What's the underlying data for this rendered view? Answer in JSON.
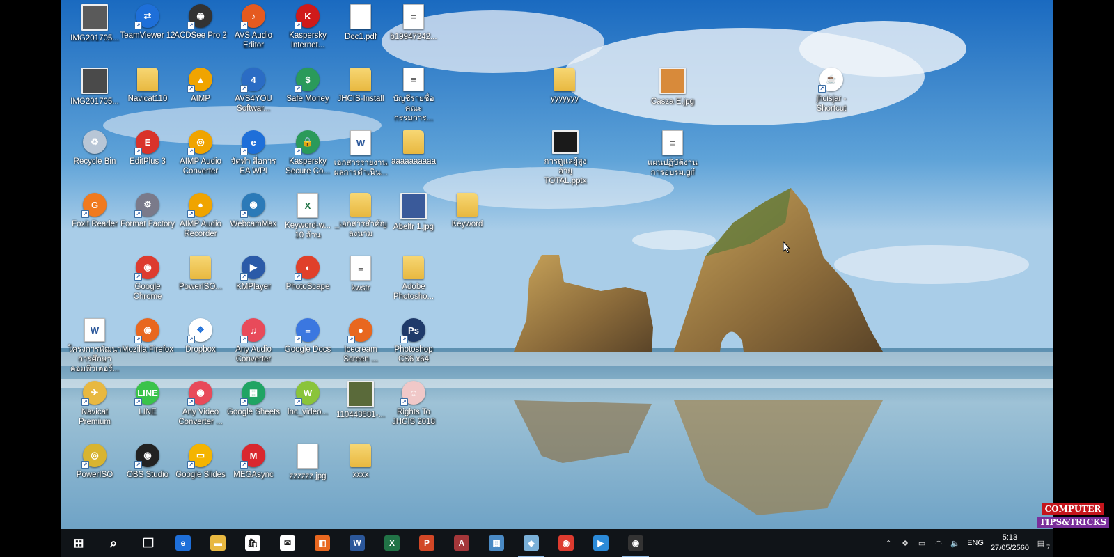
{
  "desktop": {
    "icons": [
      {
        "label": "IMG201705...",
        "name": "icon-img201705-1",
        "kind": "photo",
        "color": "#5a5a5a",
        "glyph": "",
        "shortcut": false
      },
      {
        "label": "TeamViewer 12",
        "name": "icon-teamviewer",
        "kind": "app",
        "color": "#1e6fd9",
        "glyph": "⇄",
        "shortcut": true
      },
      {
        "label": "ACDSee Pro 2",
        "name": "icon-acdsee",
        "kind": "app",
        "color": "#333",
        "glyph": "◉",
        "shortcut": true
      },
      {
        "label": "AVS Audio Editor",
        "name": "icon-avs-audio-editor",
        "kind": "app",
        "color": "#e55a1f",
        "glyph": "♪",
        "shortcut": true
      },
      {
        "label": "Kaspersky Internet...",
        "name": "icon-kaspersky-internet",
        "kind": "app",
        "color": "#d01a1a",
        "glyph": "K",
        "shortcut": true
      },
      {
        "label": "Doc1.pdf",
        "name": "icon-doc1-pdf",
        "kind": "file",
        "color": "#ffffff",
        "glyph": "",
        "shortcut": false
      },
      {
        "label": "b19947242...",
        "name": "icon-b19947242",
        "kind": "file",
        "color": "#ffffff",
        "glyph": "≡",
        "shortcut": false
      },
      {
        "label": "IMG201705...",
        "name": "icon-img201705-2",
        "kind": "photo",
        "color": "#4a4a4a",
        "glyph": "",
        "shortcut": false
      },
      {
        "label": "Navicat110",
        "name": "icon-navicat110",
        "kind": "folder",
        "color": "#e8b840",
        "glyph": "",
        "shortcut": false
      },
      {
        "label": "AIMP",
        "name": "icon-aimp",
        "kind": "app",
        "color": "#f0a400",
        "glyph": "▲",
        "shortcut": true
      },
      {
        "label": "AVS4YOU Softwar...",
        "name": "icon-avs4you",
        "kind": "app",
        "color": "#2b6cc4",
        "glyph": "4",
        "shortcut": true
      },
      {
        "label": "Safe Money",
        "name": "icon-safe-money",
        "kind": "app",
        "color": "#2a9a5a",
        "glyph": "$",
        "shortcut": true
      },
      {
        "label": "JHCIS-Install",
        "name": "icon-jhcis-install",
        "kind": "folder",
        "color": "#e8b840",
        "glyph": "",
        "shortcut": false
      },
      {
        "label": "บัญชีรายชื่อ คณะกรรมการ...",
        "name": "icon-thai-doc-1",
        "kind": "file",
        "color": "#ffffff",
        "glyph": "≡",
        "shortcut": false
      },
      {
        "label": "Recycle Bin",
        "name": "icon-recycle-bin",
        "kind": "app",
        "color": "#b8c6d6",
        "glyph": "♻",
        "shortcut": false
      },
      {
        "label": "EditPlus 3",
        "name": "icon-editplus",
        "kind": "app",
        "color": "#d9332a",
        "glyph": "E",
        "shortcut": true
      },
      {
        "label": "AIMP Audio Converter",
        "name": "icon-aimp-audio-converter",
        "kind": "app",
        "color": "#f0a400",
        "glyph": "◎",
        "shortcut": true
      },
      {
        "label": "จัดทำ สื่อการ EA WPI",
        "name": "icon-thai-ie-shortcut",
        "kind": "app",
        "color": "#1e6fd9",
        "glyph": "e",
        "shortcut": true
      },
      {
        "label": "Kaspersky Secure Co...",
        "name": "icon-kaspersky-secure",
        "kind": "app",
        "color": "#2a9a5a",
        "glyph": "🔒",
        "shortcut": true
      },
      {
        "label": "เอกสารรายงาน ผลการดำเนิน...",
        "name": "icon-thai-word-doc",
        "kind": "word",
        "color": "#2b579a",
        "glyph": "W",
        "shortcut": false
      },
      {
        "label": "aaaaaaaaaa",
        "name": "icon-aaaaaaaaaa",
        "kind": "folder",
        "color": "#e8b840",
        "glyph": "",
        "shortcut": false
      },
      {
        "label": "Foxit Reader",
        "name": "icon-foxit-reader",
        "kind": "app",
        "color": "#f07a1f",
        "glyph": "G",
        "shortcut": true
      },
      {
        "label": "Format Factory",
        "name": "icon-format-factory",
        "kind": "app",
        "color": "#7a7a8a",
        "glyph": "⚙",
        "shortcut": true
      },
      {
        "label": "AIMP Audio Recorder",
        "name": "icon-aimp-audio-recorder",
        "kind": "app",
        "color": "#f0a400",
        "glyph": "●",
        "shortcut": true
      },
      {
        "label": "WebcamMax",
        "name": "icon-webcammax",
        "kind": "app",
        "color": "#2b7ab8",
        "glyph": "◉",
        "shortcut": true
      },
      {
        "label": "Keyword-w... 10 ล้าน",
        "name": "icon-keyword-excel",
        "kind": "excel",
        "color": "#217346",
        "glyph": "X",
        "shortcut": false
      },
      {
        "label": "_เอกสารสำคัญ ลงนาม",
        "name": "icon-thai-folder",
        "kind": "folder",
        "color": "#e8b840",
        "glyph": "",
        "shortcut": false
      },
      {
        "label": "Abeltr 1.jpg",
        "name": "icon-abeltr-jpg",
        "kind": "photo",
        "color": "#3a5a9a",
        "glyph": "",
        "shortcut": false
      },
      {
        "label": "Keyword",
        "name": "icon-keyword-folder",
        "kind": "folder",
        "color": "#e8b840",
        "glyph": "",
        "shortcut": false
      },
      {
        "label": "Google Chrome",
        "name": "icon-google-chrome",
        "kind": "app",
        "color": "#dd3b2f",
        "glyph": "◉",
        "shortcut": true
      },
      {
        "label": "PowerISO...",
        "name": "icon-poweriso-folder",
        "kind": "folder",
        "color": "#e8b840",
        "glyph": "",
        "shortcut": false
      },
      {
        "label": "KMPlayer",
        "name": "icon-kmplayer",
        "kind": "app",
        "color": "#2b5aa8",
        "glyph": "▶",
        "shortcut": true
      },
      {
        "label": "PhotoScape",
        "name": "icon-photoscape",
        "kind": "app",
        "color": "#e0402a",
        "glyph": "◐",
        "shortcut": true
      },
      {
        "label": "kwstr",
        "name": "icon-kwstr",
        "kind": "file",
        "color": "#ffffff",
        "glyph": "≡",
        "shortcut": false
      },
      {
        "label": "Adobe Photosho...",
        "name": "icon-adobe-photoshop-folder",
        "kind": "folder",
        "color": "#e8b840",
        "glyph": "",
        "shortcut": false
      },
      {
        "label": "โครงการพัฒนา การศึกษาคอมพิวเตอร์...",
        "name": "icon-thai-word-doc-2",
        "kind": "word",
        "color": "#2b579a",
        "glyph": "W",
        "shortcut": false
      },
      {
        "label": "Mozilla Firefox",
        "name": "icon-mozilla-firefox",
        "kind": "app",
        "color": "#e8671f",
        "glyph": "◉",
        "shortcut": true
      },
      {
        "label": "Dropbox",
        "name": "icon-dropbox",
        "kind": "app",
        "color": "#ffffff",
        "glyph": "❖",
        "shortcut": true
      },
      {
        "label": "Any Audio Converter",
        "name": "icon-any-audio-converter",
        "kind": "app",
        "color": "#e84a5a",
        "glyph": "♫",
        "shortcut": true
      },
      {
        "label": "Google Docs",
        "name": "icon-google-docs",
        "kind": "app",
        "color": "#3b77e0",
        "glyph": "≡",
        "shortcut": true
      },
      {
        "label": "Icecream Screen ...",
        "name": "icon-icecream-screen",
        "kind": "app",
        "color": "#e8671f",
        "glyph": "●",
        "shortcut": true
      },
      {
        "label": "Photoshop CS6 x64",
        "name": "icon-photoshop-cs6",
        "kind": "app",
        "color": "#1f3a6a",
        "glyph": "Ps",
        "shortcut": true
      },
      {
        "label": "Navicat Premium",
        "name": "icon-navicat-premium",
        "kind": "app",
        "color": "#e8b840",
        "glyph": "✈",
        "shortcut": true
      },
      {
        "label": "LINE",
        "name": "icon-line",
        "kind": "app",
        "color": "#3ac34a",
        "glyph": "LINE",
        "shortcut": true
      },
      {
        "label": "Any Video Converter ...",
        "name": "icon-any-video-converter",
        "kind": "app",
        "color": "#e84a5a",
        "glyph": "◉",
        "shortcut": true
      },
      {
        "label": "Google Sheets",
        "name": "icon-google-sheets",
        "kind": "app",
        "color": "#1fa463",
        "glyph": "▦",
        "shortcut": true
      },
      {
        "label": "lnc_video...",
        "name": "icon-lnc-video",
        "kind": "app",
        "color": "#8ac43a",
        "glyph": "W",
        "shortcut": true
      },
      {
        "label": "110443581-...",
        "name": "icon-110443581",
        "kind": "photo",
        "color": "#5a6a3a",
        "glyph": "",
        "shortcut": false
      },
      {
        "label": "Rights To JHCIS 2018",
        "name": "icon-rights-to-jhcis",
        "kind": "app",
        "color": "#f0c8c8",
        "glyph": "☺",
        "shortcut": true
      },
      {
        "label": "PowerISO",
        "name": "icon-poweriso",
        "kind": "app",
        "color": "#d8b430",
        "glyph": "◎",
        "shortcut": true
      },
      {
        "label": "OBS Studio",
        "name": "icon-obs-studio",
        "kind": "app",
        "color": "#222222",
        "glyph": "◉",
        "shortcut": true
      },
      {
        "label": "Google Slides",
        "name": "icon-google-slides",
        "kind": "app",
        "color": "#f4b400",
        "glyph": "▭",
        "shortcut": true
      },
      {
        "label": "MEGAsync",
        "name": "icon-megasync",
        "kind": "app",
        "color": "#d9272e",
        "glyph": "M",
        "shortcut": true
      },
      {
        "label": "zzzzzz.jpg",
        "name": "icon-zzzzzz-jpg",
        "kind": "file",
        "color": "#ffffff",
        "glyph": "",
        "shortcut": false
      },
      {
        "label": "xxxx",
        "name": "icon-xxxx-folder",
        "kind": "folder",
        "color": "#e8b840",
        "glyph": "",
        "shortcut": false
      },
      {
        "label": "yyyyyyy",
        "name": "icon-yyyyyyy-folder",
        "kind": "folder",
        "color": "#e8b840",
        "glyph": "",
        "shortcut": false
      },
      {
        "label": "Casza E.jpg",
        "name": "icon-casza-jpg",
        "kind": "photo",
        "color": "#d88a3a",
        "glyph": "",
        "shortcut": false
      },
      {
        "label": "jhcisjar - Shortcut",
        "name": "icon-jhcisjar-shortcut",
        "kind": "app",
        "color": "#ffffff",
        "glyph": "☕",
        "shortcut": true
      },
      {
        "label": "การดูแลผู้สูงอายุ TOTAL.pptx",
        "name": "icon-thai-pptx",
        "kind": "photo",
        "color": "#1a1a1a",
        "glyph": "",
        "shortcut": false
      },
      {
        "label": "แผนปฏิบัติงาน การอบรม.gif",
        "name": "icon-thai-gif",
        "kind": "file",
        "color": "#ffffff",
        "glyph": "≡",
        "shortcut": false
      }
    ]
  },
  "taskbar": {
    "items": [
      {
        "name": "start-button",
        "glyph": "⊞",
        "color": "transparent",
        "active": false
      },
      {
        "name": "search-button",
        "glyph": "⌕",
        "color": "transparent",
        "active": false
      },
      {
        "name": "task-view-button",
        "glyph": "❐",
        "color": "transparent",
        "active": false
      },
      {
        "name": "taskbar-edge",
        "glyph": "e",
        "color": "#1e6fd9",
        "active": false
      },
      {
        "name": "taskbar-file-explorer",
        "glyph": "▬",
        "color": "#e8b840",
        "active": false
      },
      {
        "name": "taskbar-store",
        "glyph": "🛍",
        "color": "#ffffff",
        "active": false
      },
      {
        "name": "taskbar-mail",
        "glyph": "✉",
        "color": "#ffffff",
        "active": false
      },
      {
        "name": "taskbar-app-orange",
        "glyph": "◧",
        "color": "#e8671f",
        "active": false
      },
      {
        "name": "taskbar-word",
        "glyph": "W",
        "color": "#2b579a",
        "active": false
      },
      {
        "name": "taskbar-excel",
        "glyph": "X",
        "color": "#217346",
        "active": false
      },
      {
        "name": "taskbar-powerpoint",
        "glyph": "P",
        "color": "#d24726",
        "active": false
      },
      {
        "name": "taskbar-access",
        "glyph": "A",
        "color": "#a4373a",
        "active": false
      },
      {
        "name": "taskbar-app-photo",
        "glyph": "▦",
        "color": "#4a8ac4",
        "active": false
      },
      {
        "name": "taskbar-app-blue",
        "glyph": "◆",
        "color": "#7ab0d8",
        "active": true
      },
      {
        "name": "taskbar-chrome",
        "glyph": "◉",
        "color": "#dd3b2f",
        "active": false
      },
      {
        "name": "taskbar-media",
        "glyph": "▶",
        "color": "#2b8ad8",
        "active": false
      },
      {
        "name": "taskbar-obs",
        "glyph": "◉",
        "color": "#333333",
        "active": true
      }
    ],
    "tray": {
      "language": "ENG",
      "time": "5:13",
      "date": "27/05/2560",
      "notification_count": "7"
    }
  },
  "watermark": {
    "line1": "COMPUTER",
    "line2": "TIPS&TRICKS"
  }
}
